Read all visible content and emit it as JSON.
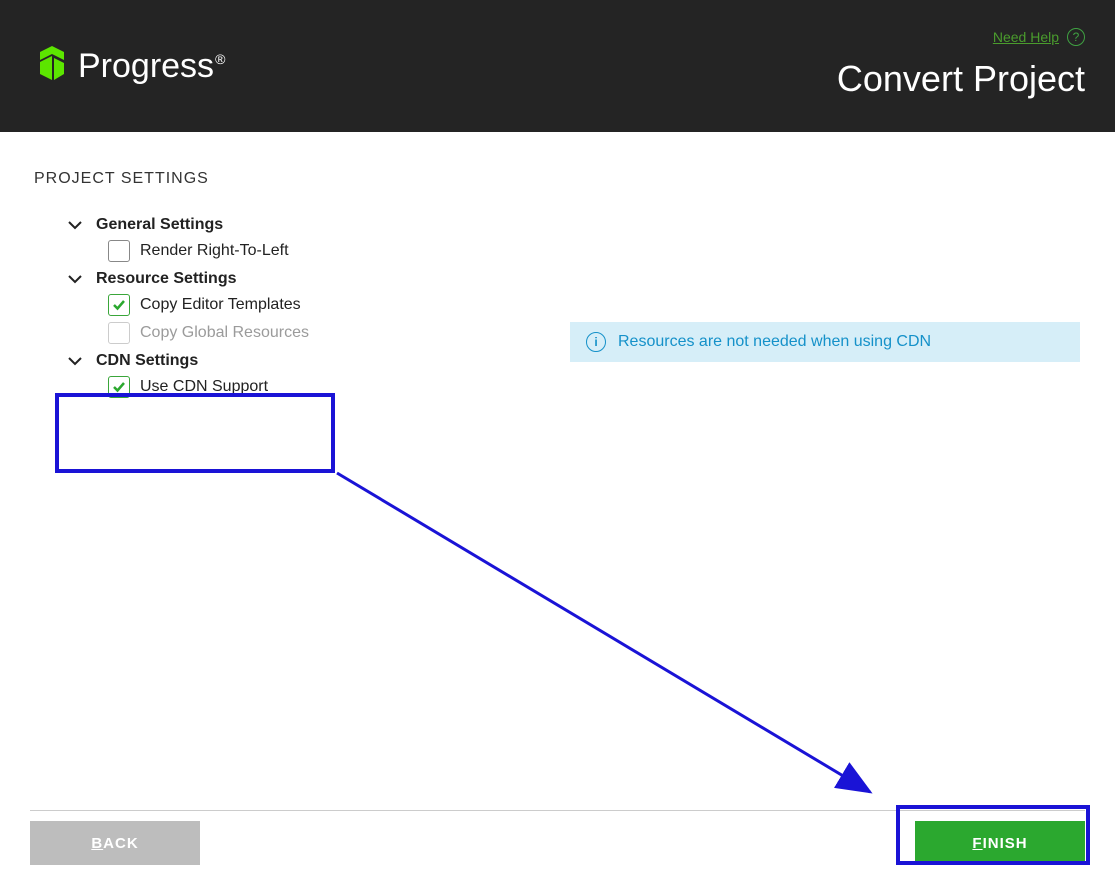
{
  "header": {
    "logo_text": "Progress",
    "help_label": "Need Help",
    "page_title": "Convert Project"
  },
  "section_title": "PROJECT SETTINGS",
  "groups": {
    "general": {
      "label": "General Settings",
      "options": {
        "rtl": {
          "label": "Render Right-To-Left",
          "checked": false,
          "enabled": true
        }
      }
    },
    "resource": {
      "label": "Resource Settings",
      "options": {
        "copy_templates": {
          "label": "Copy Editor Templates",
          "checked": true,
          "enabled": true
        },
        "copy_global": {
          "label": "Copy Global Resources",
          "checked": false,
          "enabled": false
        }
      }
    },
    "cdn": {
      "label": "CDN Settings",
      "options": {
        "use_cdn": {
          "label": "Use CDN Support",
          "checked": true,
          "enabled": true
        }
      }
    }
  },
  "info_message": "Resources are not needed when using CDN",
  "buttons": {
    "back": "BACK",
    "finish": "FINISH"
  }
}
